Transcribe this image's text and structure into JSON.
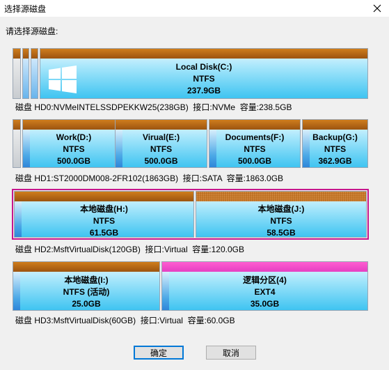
{
  "window": {
    "title": "选择源磁盘",
    "close_icon": "close-icon"
  },
  "prompt": "请选择源磁盘:",
  "disks": [
    {
      "info": "磁盘 HD0:NVMeINTELSSDPEKKW25(238GB)  接口:NVMe  容量:238.5GB",
      "partitions": [
        {
          "name": "Local Disk(C:)",
          "fs": "NTFS",
          "size": "237.9GB",
          "icon": "windows-logo-icon"
        }
      ]
    },
    {
      "info": "磁盘 HD1:ST2000DM008-2FR102(1863GB)  接口:SATA  容量:1863.0GB",
      "partitions": [
        {
          "name": "Work(D:)",
          "fs": "NTFS",
          "size": "500.0GB"
        },
        {
          "name": "Virual(E:)",
          "fs": "NTFS",
          "size": "500.0GB"
        },
        {
          "name": "Documents(F:)",
          "fs": "NTFS",
          "size": "500.0GB"
        },
        {
          "name": "Backup(G:)",
          "fs": "NTFS",
          "size": "362.9GB"
        }
      ]
    },
    {
      "info": "磁盘 HD2:MsftVirtualDisk(120GB)  接口:Virtual  容量:120.0GB",
      "selected": true,
      "partitions": [
        {
          "name": "本地磁盘(H:)",
          "fs": "NTFS",
          "size": "61.5GB"
        },
        {
          "name": "本地磁盘(J:)",
          "fs": "NTFS",
          "size": "58.5GB"
        }
      ]
    },
    {
      "info": "磁盘 HD3:MsftVirtualDisk(60GB)  接口:Virtual  容量:60.0GB",
      "partitions": [
        {
          "name": "本地磁盘(I:)",
          "fs": "NTFS (活动)",
          "size": "25.0GB"
        },
        {
          "name": "逻辑分区(4)",
          "fs": "EXT4",
          "size": "35.0GB"
        }
      ]
    }
  ],
  "buttons": {
    "ok": "确定",
    "cancel": "取消"
  },
  "colors": {
    "selection_border": "#c6168c",
    "partition_cap": "#b86b1b",
    "logical_partition_cap": "#ff5ed1",
    "partition_fill": "#3fc4f1"
  }
}
